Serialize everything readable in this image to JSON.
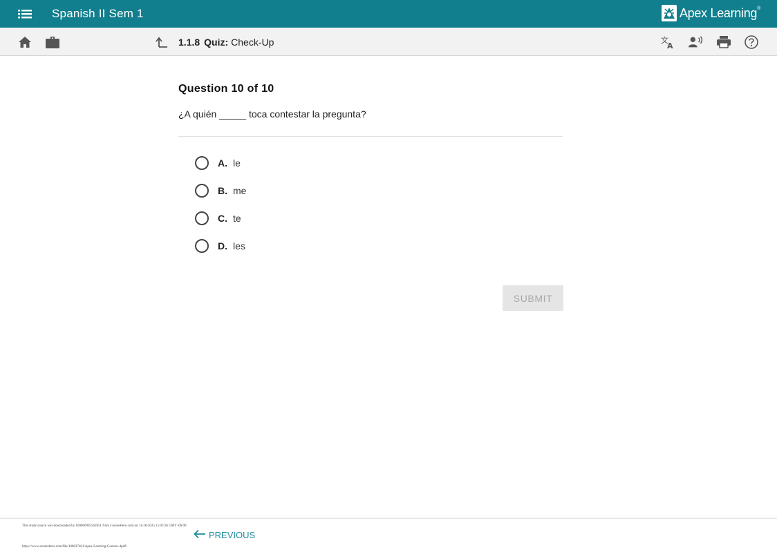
{
  "header": {
    "course_title": "Spanish II Sem 1",
    "brand_name": "Apex Learning",
    "brand_mark": "®",
    "background_color": "#127f8e"
  },
  "toolbar": {
    "icons": [
      "home-icon",
      "briefcase-icon",
      "up-arrow-icon",
      "translate-icon",
      "read-aloud-icon",
      "print-icon",
      "help-icon"
    ],
    "breadcrumb": {
      "number": "1.1.8",
      "kind": "Quiz:",
      "title": "Check-Up"
    }
  },
  "question": {
    "heading": "Question 10 of 10",
    "prompt": "¿A quién _____ toca contestar la pregunta?",
    "options": [
      {
        "letter": "A.",
        "text": "le"
      },
      {
        "letter": "B.",
        "text": "me"
      },
      {
        "letter": "C.",
        "text": "te"
      },
      {
        "letter": "D.",
        "text": "les"
      }
    ],
    "submit_label": "SUBMIT"
  },
  "footer": {
    "source_line1": "This study source was downloaded by 100000902562851 from CourseHero.com on 11-26-2025 15:03:36 GMT -06:00",
    "source_line2": "https://www.coursehero.com/file/100837481/Apex-Learning-Courses-4pdf/",
    "previous_label": "PREVIOUS",
    "accent_color": "#1a8a9a"
  }
}
